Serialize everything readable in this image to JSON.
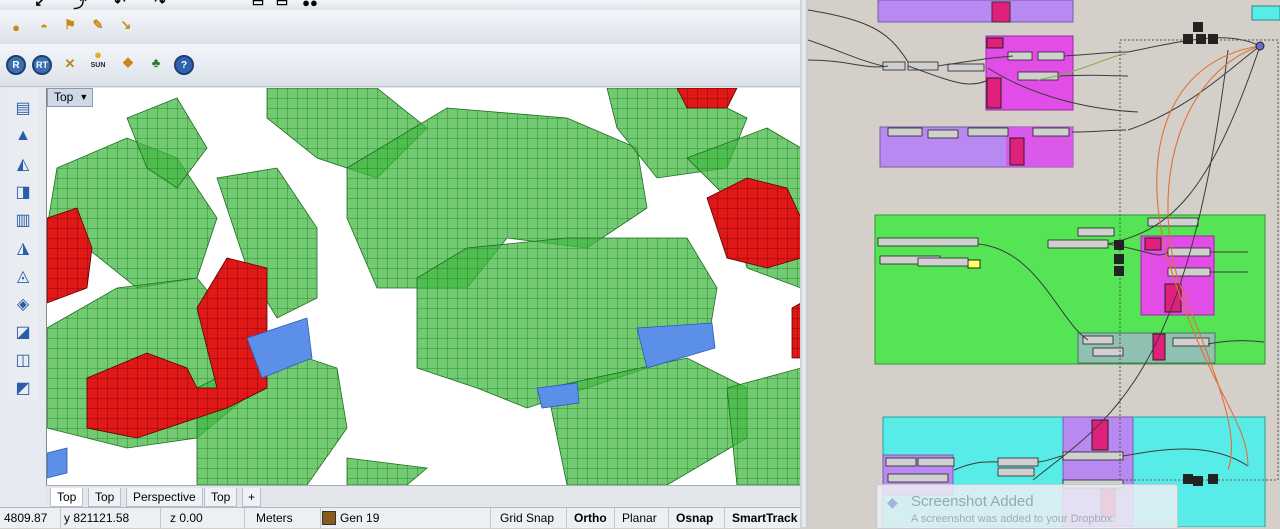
{
  "viewport": {
    "name": "Top",
    "tabs": [
      "Top",
      "Top",
      "Perspective",
      "Top"
    ],
    "add_tab": "+"
  },
  "toolbar_row2": {
    "sun_label": "SUN"
  },
  "toolbar_row3": {
    "r_label": "R",
    "rt_label": "RT",
    "help_label": "?"
  },
  "status": {
    "x": "4809.87",
    "y": "y 821121.58",
    "z": "z 0.00",
    "units": "Meters",
    "layer": "Gen 19",
    "grid_snap": "Grid Snap",
    "ortho": "Ortho",
    "planar": "Planar",
    "osnap": "Osnap",
    "smarttrack": "SmartTrack"
  },
  "notification": {
    "title": "Screenshot Added",
    "message": "A screenshot was added to your Dropbox."
  },
  "colors": {
    "building_green": "#3fbf3f",
    "building_red": "#e01818",
    "highlight_blue": "#5b8fe8",
    "group_purple": "#b889f0",
    "group_green": "#55e455",
    "group_cyan": "#58ece8",
    "component_magenta": "#e24de8",
    "wire_orange": "#e0703a"
  }
}
